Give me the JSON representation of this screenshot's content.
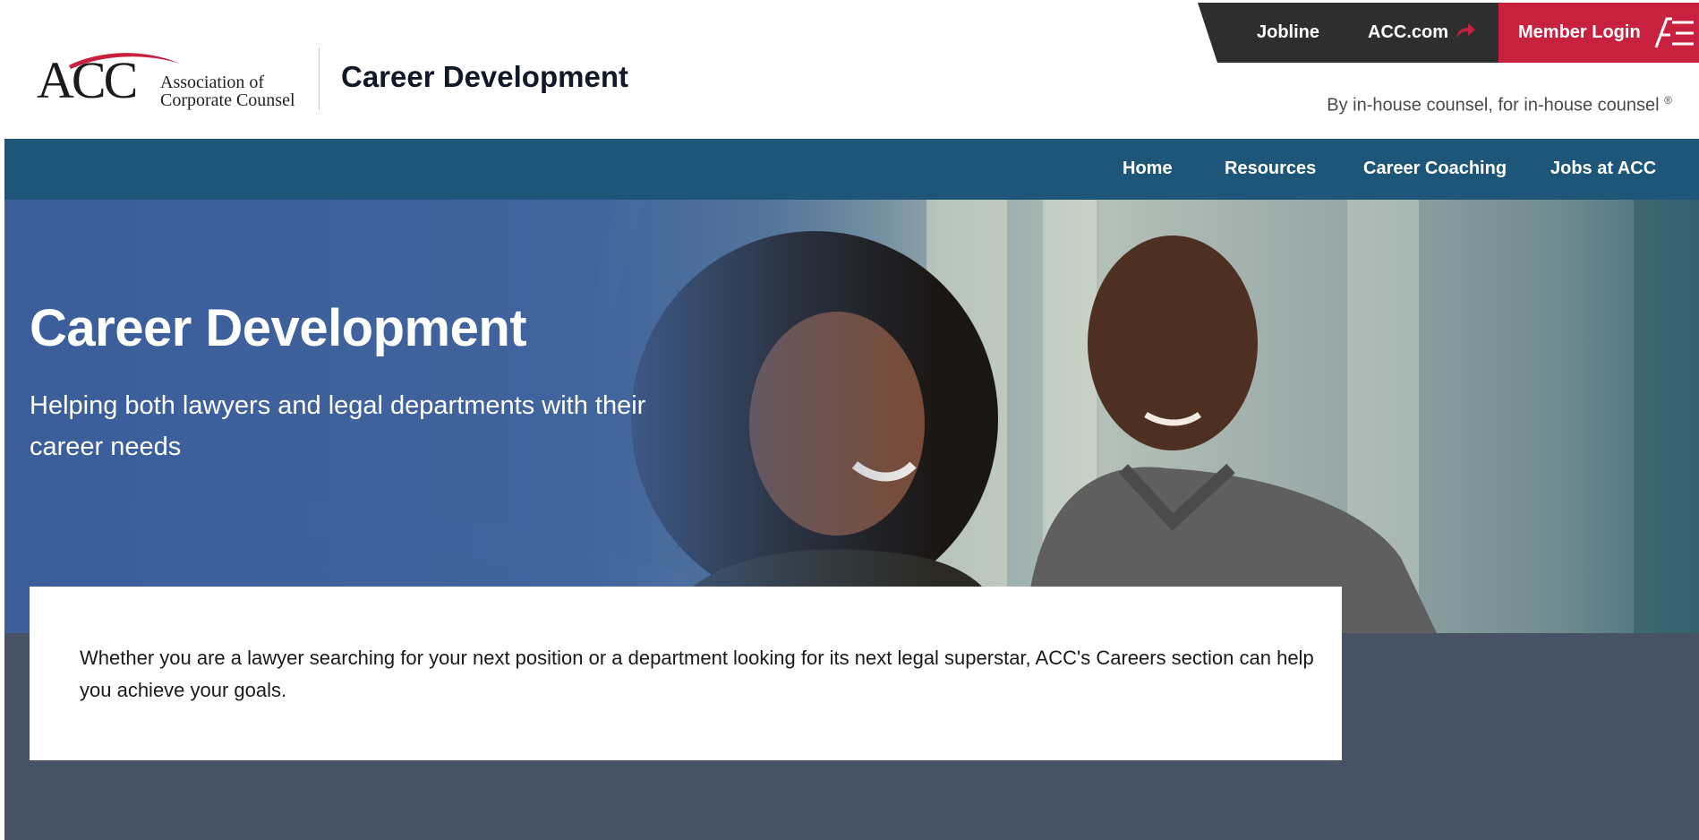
{
  "header": {
    "logo_acc": "ACC",
    "logo_org_line1": "Association of",
    "logo_org_line2": "Corporate Counsel",
    "site_title": "Career Development",
    "tagline": "By in-house counsel, for in-house counsel",
    "tagline_mark": "®"
  },
  "utility": {
    "jobline": "Jobline",
    "acc_com": "ACC.com",
    "member_login": "Member Login"
  },
  "nav": {
    "items": [
      {
        "label": "Home"
      },
      {
        "label": "Resources"
      },
      {
        "label": "Career Coaching"
      },
      {
        "label": "Jobs at ACC"
      }
    ]
  },
  "hero": {
    "title": "Career Development",
    "subtitle": "Helping both lawyers and legal departments with their career needs"
  },
  "intro": {
    "text": "Whether you are a lawyer searching for your next position or a department looking for its next legal superstar, ACC's Careers section can help you achieve your goals."
  },
  "colors": {
    "brand_red": "#c8203f",
    "nav_blue": "#1d5679",
    "utility_dark": "#2e2e2e",
    "lower_bg": "#475364"
  },
  "icons": {
    "external": "share-arrow-icon",
    "login": "ae-logo-icon"
  }
}
